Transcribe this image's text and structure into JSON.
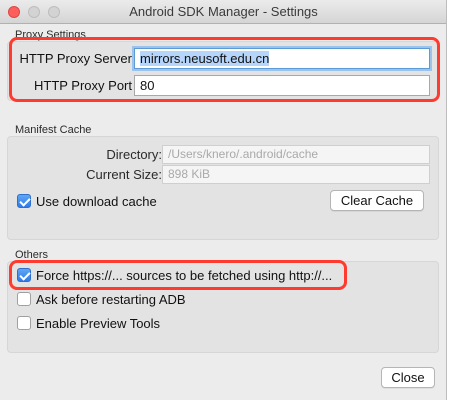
{
  "window": {
    "title": "Android SDK Manager - Settings"
  },
  "proxy": {
    "section_label": "Proxy Settings",
    "server_label": "HTTP Proxy Server",
    "server_value": "mirrors.neusoft.edu.cn",
    "port_label": "HTTP Proxy Port",
    "port_value": "80"
  },
  "manifest": {
    "section_label": "Manifest Cache",
    "directory_label": "Directory:",
    "directory_value": "/Users/knero/.android/cache",
    "size_label": "Current Size:",
    "size_value": "898 KiB",
    "use_cache_label": "Use download cache",
    "use_cache_checked": true,
    "clear_button": "Clear Cache"
  },
  "others": {
    "section_label": "Others",
    "options": [
      {
        "label": "Force https://... sources to be fetched using http://...",
        "checked": true
      },
      {
        "label": "Ask before restarting ADB",
        "checked": false
      },
      {
        "label": "Enable Preview Tools",
        "checked": false
      }
    ]
  },
  "footer": {
    "close_button": "Close"
  },
  "colors": {
    "annotation": "#ff3b30",
    "accent": "#2f7be8",
    "focus_ring": "#9cc3ec"
  }
}
